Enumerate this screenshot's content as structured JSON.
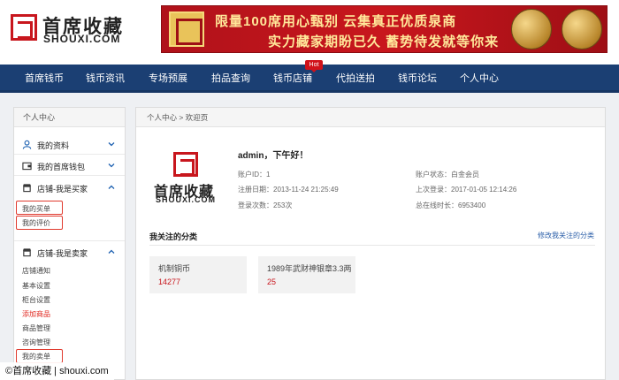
{
  "header": {
    "logo_cn": "首席收藏",
    "logo_en": "SHOUXI.COM",
    "banner_line1": "限量100席用心甄别 云集真正优质泉商",
    "banner_line2": "实力藏家期盼已久 蓄势待发就等你来"
  },
  "nav": {
    "items": [
      "首席钱币",
      "钱币资讯",
      "专场预展",
      "拍品查询",
      "钱币店铺",
      "代拍送拍",
      "钱币论坛",
      "个人中心"
    ],
    "hot_badge": "Hot"
  },
  "sidebar": {
    "title": "个人中心",
    "my_profile": "我的资料",
    "my_wallet": "我的首席钱包",
    "buyer_section": "店铺-我是买家",
    "buyer_items": [
      "我的买单",
      "我的评价"
    ],
    "seller_section": "店铺-我是卖家",
    "seller_items": [
      "店铺通知",
      "基本设置",
      "柜台设置",
      "添加商品",
      "商品管理",
      "咨询管理",
      "我的卖单"
    ]
  },
  "main": {
    "breadcrumb": "个人中心 > 欢迎页",
    "greeting": "admin，下午好！",
    "account_id": "账户ID：1",
    "register_date": "注册日期：2013-11-24 21:25:49",
    "login_count": "登录次数：253次",
    "account_status": "账户状态：白金会员",
    "last_login": "上次登录：2017-01-05 12:14:26",
    "online_time": "总在线时长：6953400",
    "followed_title": "我关注的分类",
    "edit_followed": "修改我关注的分类",
    "categories": [
      {
        "name": "机制铜币",
        "count": "14277"
      },
      {
        "name": "1989年武财神银章3.3两",
        "count": "25"
      }
    ]
  },
  "watermark": "©首席收藏 | shouxi.com",
  "colors": {
    "brand_red": "#c8161d",
    "nav_blue": "#1b3f73",
    "link_blue": "#2a5ea8",
    "highlight_red": "#e03a2e"
  }
}
